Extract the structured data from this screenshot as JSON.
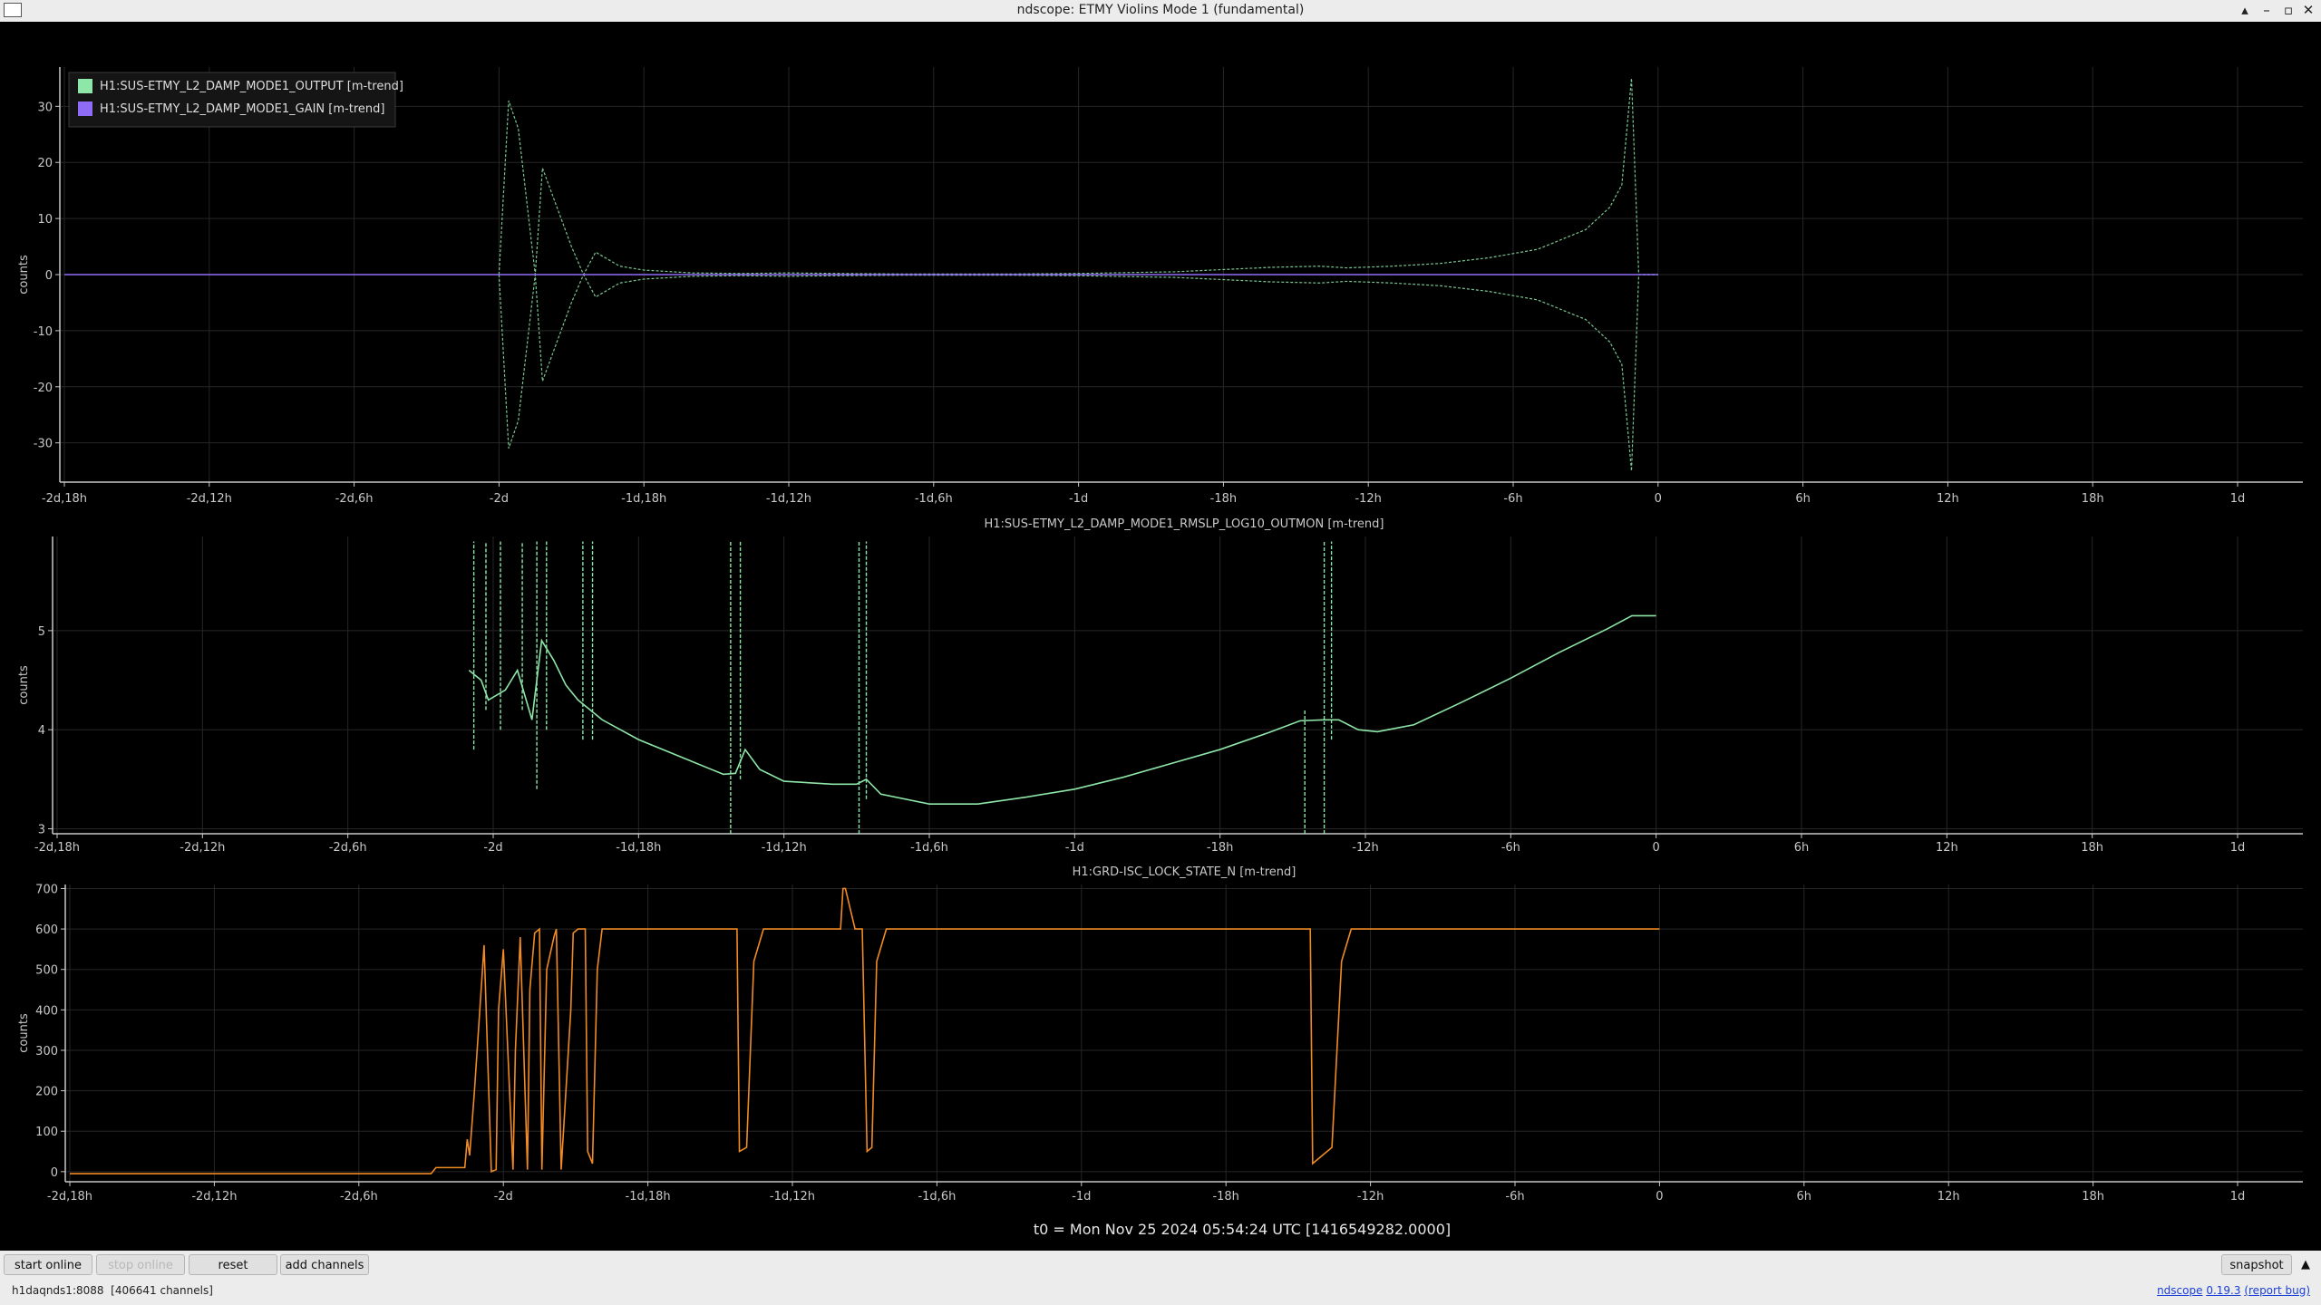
{
  "window": {
    "title": "ndscope: ETMY Violins Mode 1 (fundamental)",
    "controls": [
      "▴",
      "–",
      "▫",
      "✕"
    ]
  },
  "colors": {
    "output": "#8ee6a8",
    "gain": "#8f6cf5",
    "lock": "#f08a24",
    "rms": "#8ee6a8",
    "grid": "#262626",
    "axis": "#c8c8c8"
  },
  "time_axis": {
    "ticks": [
      "-2d,18h",
      "-2d,12h",
      "-2d,6h",
      "-2d",
      "-1d,18h",
      "-1d,12h",
      "-1d,6h",
      "-1d",
      "-18h",
      "-12h",
      "-6h",
      "0",
      "6h",
      "12h",
      "18h",
      "1d"
    ],
    "units": "hours",
    "range": [
      -66,
      24
    ]
  },
  "t0_label": "t0 = Mon Nov 25 2024 05:54:24 UTC [1416549282.0000]",
  "chart_data": [
    {
      "type": "line",
      "title": "",
      "ylabel": "counts",
      "ylim": [
        -37,
        37
      ],
      "yticks": [
        30,
        20,
        10,
        0,
        -10,
        -20,
        -30
      ],
      "legend": {
        "placement": "top-left"
      },
      "series": [
        {
          "name": "H1:SUS-ETMY_L2_DAMP_MODE1_OUTPUT [m-trend]",
          "style": "envelope",
          "x": [
            -48,
            -47.6,
            -47.2,
            -46.5,
            -46.2,
            -45,
            -44.5,
            -44,
            -43,
            -42,
            -40,
            -38,
            -36,
            -34,
            -31,
            -30,
            -27,
            -24,
            -20,
            -16,
            -14,
            -12.9,
            -11,
            -9,
            -7,
            -5,
            -3,
            -2,
            -1.5,
            -1.1,
            -0.8,
            0
          ],
          "y": [
            0,
            31,
            26,
            0,
            19,
            5,
            0,
            4,
            1.5,
            0.8,
            0.3,
            0.2,
            0.3,
            0.2,
            0.1,
            0.1,
            0.1,
            0.2,
            0.5,
            1.3,
            1.5,
            1.2,
            1.5,
            2,
            3,
            4.5,
            8,
            12,
            16,
            35,
            0,
            0
          ]
        },
        {
          "name": "H1:SUS-ETMY_L2_DAMP_MODE1_GAIN [m-trend]",
          "style": "line",
          "x": [
            -66,
            0
          ],
          "y": [
            0,
            0
          ]
        }
      ]
    },
    {
      "type": "line",
      "title": "H1:SUS-ETMY_L2_DAMP_MODE1_RMSLP_LOG10_OUTMON [m-trend]",
      "ylabel": "counts",
      "ylim": [
        2.95,
        5.95
      ],
      "yticks": [
        5,
        4,
        3
      ],
      "series": [
        {
          "name": "H1:SUS-ETMY_L2_DAMP_MODE1_RMSLP_LOG10_OUTMON [m-trend]",
          "x": [
            -49,
            -48.5,
            -48.2,
            -47.5,
            -47,
            -46.4,
            -46,
            -45.5,
            -45,
            -44.5,
            -43.5,
            -42,
            -40,
            -39,
            -38.5,
            -38,
            -37.6,
            -37,
            -36,
            -34,
            -33,
            -32.6,
            -32,
            -30,
            -28,
            -26,
            -24,
            -22,
            -20,
            -18,
            -16,
            -14.7,
            -13.7,
            -13.1,
            -12.3,
            -11.5,
            -10,
            -8,
            -6,
            -4,
            -2,
            -1,
            0
          ],
          "y": [
            4.6,
            4.5,
            4.3,
            4.4,
            4.6,
            4.1,
            4.9,
            4.7,
            4.45,
            4.3,
            4.1,
            3.9,
            3.7,
            3.6,
            3.55,
            3.56,
            3.8,
            3.6,
            3.48,
            3.45,
            3.45,
            3.5,
            3.35,
            3.25,
            3.25,
            3.32,
            3.4,
            3.52,
            3.66,
            3.8,
            3.97,
            4.09,
            4.1,
            4.1,
            4.0,
            3.98,
            4.05,
            4.28,
            4.52,
            4.78,
            5.02,
            5.15,
            5.15
          ],
          "spikes": [
            {
              "x": -48.8,
              "from": 3.8,
              "to": 5.9
            },
            {
              "x": -48.3,
              "from": 4.2,
              "to": 5.9
            },
            {
              "x": -47.7,
              "from": 4.0,
              "to": 5.9
            },
            {
              "x": -46.8,
              "from": 4.2,
              "to": 5.9
            },
            {
              "x": -46.2,
              "from": 3.4,
              "to": 5.9
            },
            {
              "x": -45.8,
              "from": 4.0,
              "to": 5.9
            },
            {
              "x": -44.3,
              "from": 3.9,
              "to": 5.9
            },
            {
              "x": -43.9,
              "from": 3.9,
              "to": 5.9
            },
            {
              "x": -38.2,
              "from": 2.95,
              "to": 5.9
            },
            {
              "x": -37.8,
              "from": 3.5,
              "to": 5.9
            },
            {
              "x": -32.9,
              "from": 2.95,
              "to": 5.9
            },
            {
              "x": -32.6,
              "from": 3.3,
              "to": 5.9
            },
            {
              "x": -14.5,
              "from": 2.95,
              "to": 4.2
            },
            {
              "x": -13.7,
              "from": 2.95,
              "to": 5.9
            },
            {
              "x": -13.4,
              "from": 3.9,
              "to": 5.9
            }
          ]
        }
      ]
    },
    {
      "type": "line",
      "title": "H1:GRD-ISC_LOCK_STATE_N [m-trend]",
      "ylabel": "counts",
      "ylim": [
        -25,
        710
      ],
      "yticks": [
        700,
        600,
        500,
        400,
        300,
        200,
        100,
        0
      ],
      "series": [
        {
          "name": "H1:GRD-ISC_LOCK_STATE_N [m-trend]",
          "x": [
            -66,
            -51,
            -50.8,
            -49.6,
            -49.5,
            -49.4,
            -49.2,
            -48.8,
            -48.5,
            -48.3,
            -48.2,
            -48,
            -47.6,
            -47.5,
            -47.3,
            -47,
            -46.9,
            -46.7,
            -46.5,
            -46.4,
            -46.2,
            -45.9,
            -45.8,
            -45.6,
            -45.2,
            -45.1,
            -44.9,
            -44.6,
            -44.5,
            -44.3,
            -44.1,
            -43.9,
            -43,
            -38.3,
            -38.2,
            -37.9,
            -37.6,
            -37.2,
            -34,
            -33.9,
            -33.8,
            -33.4,
            -33.1,
            -32.9,
            -32.7,
            -32.5,
            -32.1,
            -14.5,
            -14.4,
            -13.6,
            -13.2,
            -12.8,
            0
          ],
          "y": [
            -5,
            -5,
            10,
            10,
            80,
            40,
            200,
            560,
            0,
            5,
            400,
            550,
            5,
            300,
            580,
            5,
            450,
            590,
            600,
            5,
            500,
            580,
            600,
            5,
            400,
            590,
            600,
            600,
            50,
            20,
            500,
            600,
            600,
            600,
            50,
            60,
            520,
            600,
            600,
            700,
            700,
            600,
            600,
            50,
            60,
            520,
            600,
            600,
            20,
            60,
            520,
            600,
            600
          ]
        }
      ]
    }
  ],
  "toolbar": {
    "start_online": "start online",
    "stop_online": "stop online",
    "reset": "reset",
    "add_channels": "add channels",
    "snapshot": "snapshot",
    "expand": "▲"
  },
  "status": {
    "server": "h1daqnds1:8088",
    "channels": "[406641 channels]",
    "app_name": "ndscope",
    "version": "0.19.3",
    "report": "(report bug)"
  }
}
